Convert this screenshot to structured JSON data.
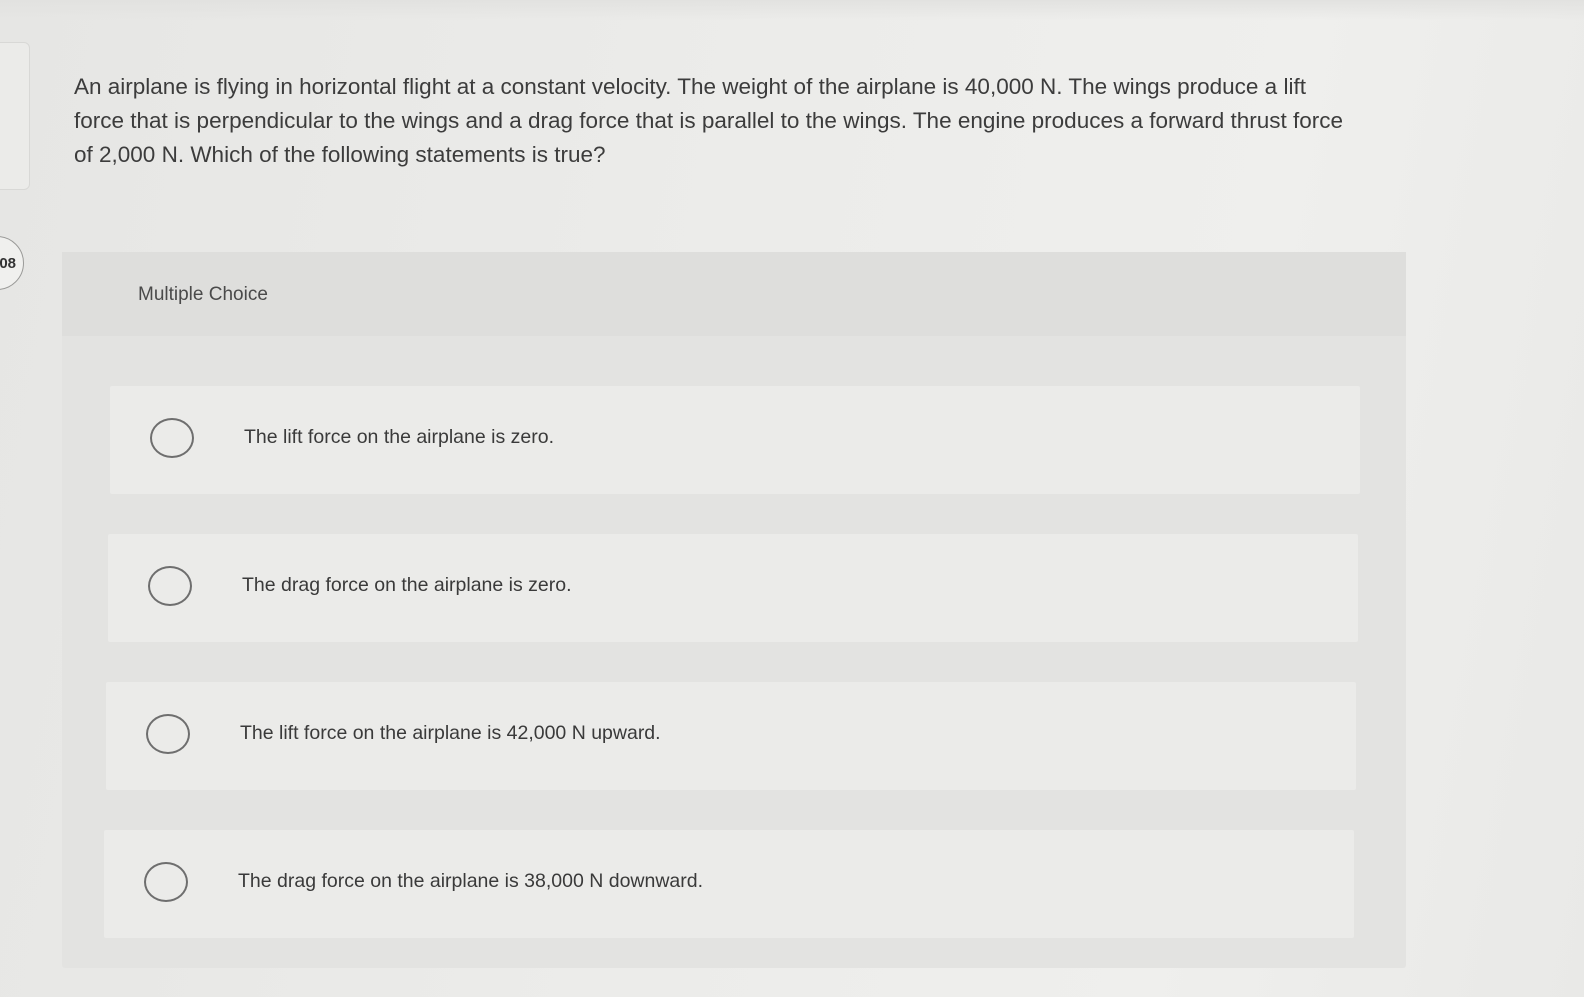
{
  "side": {
    "question_number_fragment": "08"
  },
  "question": {
    "text": "An airplane is flying in horizontal flight at a constant velocity. The weight of the airplane is 40,000 N. The wings produce a lift force that is perpendicular to the wings and a drag force that is parallel to the wings. The engine produces a forward thrust force of 2,000 N. Which of the following statements is true?"
  },
  "multiple_choice": {
    "label": "Multiple Choice",
    "options": [
      {
        "text": "The lift force on the airplane is zero.",
        "selected": false
      },
      {
        "text": "The drag force on the airplane is zero.",
        "selected": false
      },
      {
        "text": "The lift force on the airplane is 42,000 N upward.",
        "selected": false
      },
      {
        "text": "The drag force on the airplane is 38,000 N downward.",
        "selected": false
      }
    ]
  },
  "colors": {
    "background": "#ececea",
    "panel": "#e3e3e1",
    "option_background": "#ebebe9",
    "text": "#3a3a3a",
    "radio_border": "#6e6e6e"
  }
}
